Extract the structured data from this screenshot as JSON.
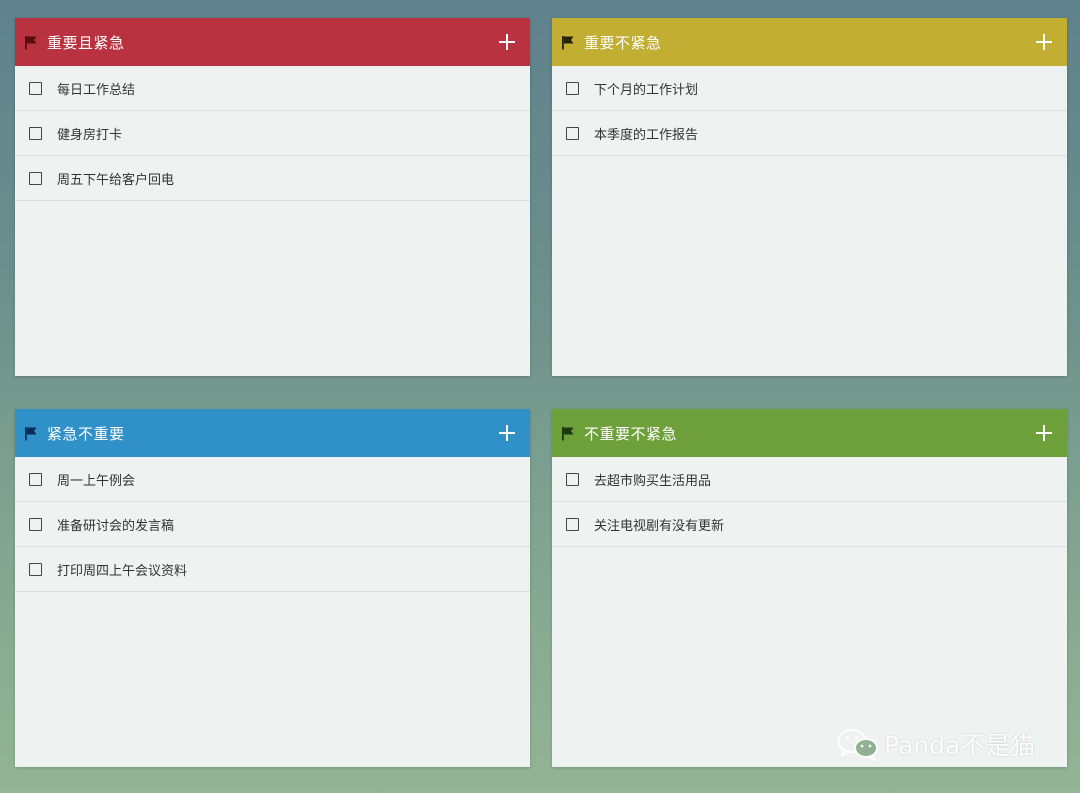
{
  "colors": {
    "q1_header": "#b8323f",
    "q1_flag": "#5a0b12",
    "q2_header": "#c2ae33",
    "q2_flag": "#2a2205",
    "q3_header": "#2f91c7",
    "q3_flag": "#0a2d5a",
    "q4_header": "#6da03a",
    "q4_flag": "#1a3a0c"
  },
  "quadrants": [
    {
      "title": "重要且紧急",
      "tasks": [
        "每日工作总结",
        "健身房打卡",
        "周五下午给客户回电"
      ]
    },
    {
      "title": "重要不紧急",
      "tasks": [
        "下个月的工作计划",
        "本季度的工作报告"
      ]
    },
    {
      "title": "紧急不重要",
      "tasks": [
        "周一上午例会",
        "准备研讨会的发言稿",
        "打印周四上午会议资料"
      ]
    },
    {
      "title": "不重要不紧急",
      "tasks": [
        "去超市购买生活用品",
        "关注电视剧有没有更新"
      ]
    }
  ],
  "watermark": {
    "text": "Panda不是猫"
  }
}
